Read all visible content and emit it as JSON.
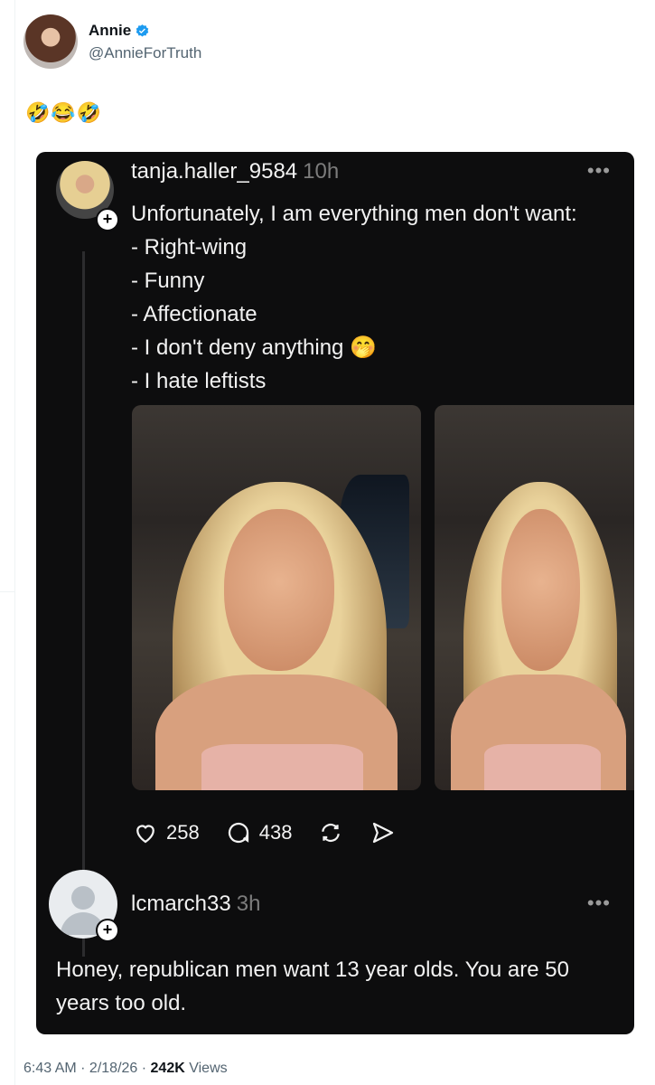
{
  "tweet": {
    "author_name": "Annie",
    "author_handle": "@AnnieForTruth",
    "text": "🤣😂🤣",
    "timestamp": "6:43 AM · 2/18/26 · ",
    "views_count": "242K",
    "views_label": " Views"
  },
  "embedded_post": {
    "username": "tanja.haller_9584",
    "time": "10h",
    "more_label": "•••",
    "lines": [
      "Unfortunately, I am everything men don't want:",
      "- Right-wing",
      "- Funny",
      "- Affectionate",
      "- I don't deny anything 🤭",
      "- I hate leftists"
    ],
    "likes": "258",
    "comments": "438"
  },
  "reply": {
    "username": "lcmarch33",
    "time": "3h",
    "more_label": "•••",
    "text": "Honey, republican men want 13 year olds. You are 50 years too old."
  },
  "colors": {
    "card_bg": "#0d0d0e",
    "verified_blue": "#1d9bf0",
    "muted_text": "#536471"
  },
  "icons": [
    "verified-badge-icon",
    "heart-icon",
    "comment-icon",
    "repost-icon",
    "share-icon",
    "plus-icon",
    "more-icon"
  ]
}
